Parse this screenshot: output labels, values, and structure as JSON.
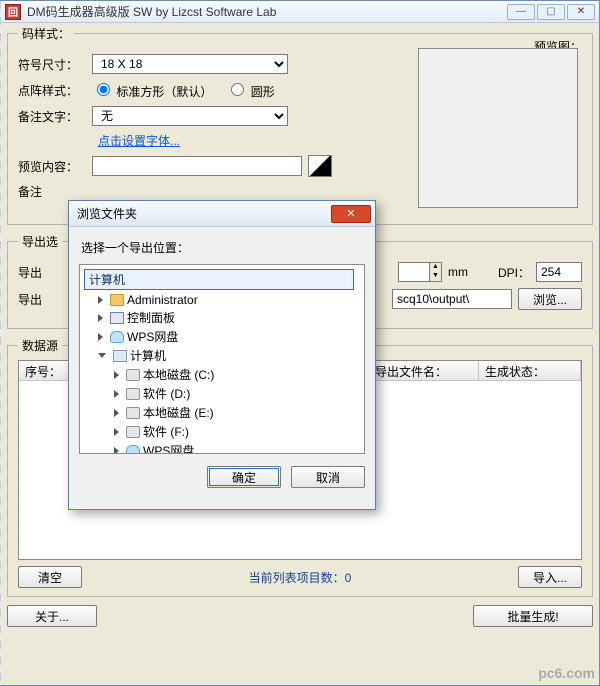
{
  "window": {
    "title": "DM码生成器高级版 SW  by Lizcst Software Lab",
    "icon_letter": "回"
  },
  "style_group": {
    "legend": "码样式：",
    "symbol_size_label": "符号尺寸：",
    "symbol_size_value": "18 X 18",
    "dot_style_label": "点阵样式：",
    "dot_style_square": "标准方形（默认）",
    "dot_style_circle": "圆形",
    "note_text_label": "备注文字：",
    "note_text_value": "无",
    "font_link": "点击设置字体...",
    "preview_content_label": "预览内容：",
    "preview_content_value": "",
    "note_underprefix": "备注",
    "preview_panel_label": "预览图："
  },
  "export_group": {
    "legend": "导出选",
    "line1_prefix": "导出",
    "spin_value": "",
    "mm_unit": "mm",
    "dpi_label": "DPI：",
    "dpi_value": "254",
    "line2_prefix": "导出",
    "path_fragment": "scq10\\output\\",
    "browse_btn": "浏览..."
  },
  "data_group": {
    "legend": "数据源",
    "columns": [
      "序号：",
      "",
      "",
      "导出文件名：",
      "生成状态："
    ]
  },
  "bottom": {
    "clear_btn": "清空",
    "status": "当前列表项目数：0",
    "import_btn": "导入...",
    "about_btn": "关于...",
    "batch_btn": "批量生成!"
  },
  "dialog": {
    "title": "浏览文件夹",
    "prompt": "选择一个导出位置：",
    "root_input": "计算机",
    "tree": {
      "admin": "Administrator",
      "control_panel": "控制面板",
      "wps": "WPS网盘",
      "computer": "计算机",
      "drives": [
        "本地磁盘 (C:)",
        "软件 (D:)",
        "本地磁盘 (E:)",
        "软件 (F:)",
        "WPS网盘"
      ]
    },
    "ok": "确定",
    "cancel": "取消"
  },
  "watermark": "pc6.com"
}
